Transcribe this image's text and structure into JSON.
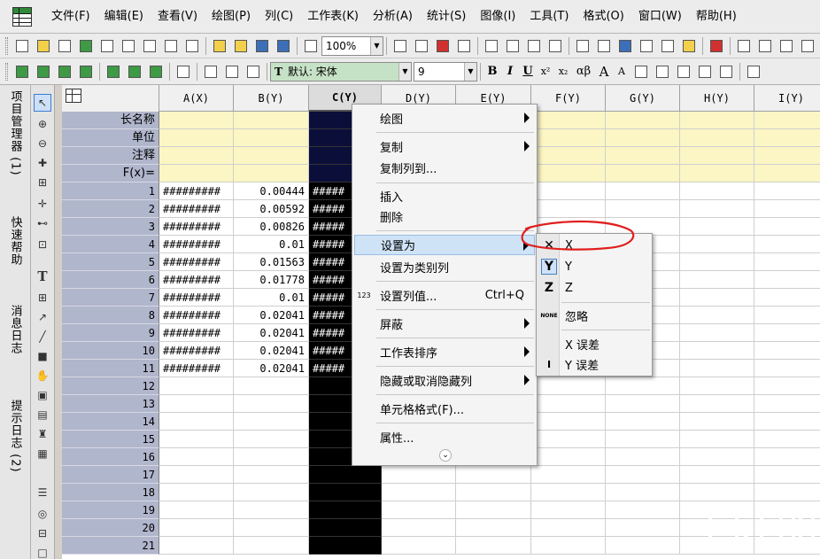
{
  "menubar": {
    "items": [
      "文件(F)",
      "编辑(E)",
      "查看(V)",
      "绘图(P)",
      "列(C)",
      "工作表(K)",
      "分析(A)",
      "统计(S)",
      "图像(I)",
      "工具(T)",
      "格式(O)",
      "窗口(W)",
      "帮助(H)"
    ]
  },
  "toolbar": {
    "zoom": "100%",
    "font": "默认: 宋体",
    "font_size": "9",
    "bold": "B",
    "italic": "I",
    "underline": "U",
    "superscript": "x²",
    "subscript": "x₂",
    "greek": "αβ",
    "grow_font": "A",
    "shrink_font": "A"
  },
  "side_tabs": [
    "项目管理器 (1)",
    "快速帮助",
    "消息日志",
    "提示日志 (2)"
  ],
  "sheet": {
    "columns": [
      "A(X)",
      "B(Y)",
      "C(Y)",
      "D(Y)",
      "E(Y)",
      "F(Y)",
      "G(Y)",
      "H(Y)",
      "I(Y)"
    ],
    "meta_rows": [
      "长名称",
      "单位",
      "注释",
      "F(x)="
    ],
    "rows": [
      {
        "n": "1",
        "a": "#########",
        "b": "0.00444",
        "c": "#####"
      },
      {
        "n": "2",
        "a": "#########",
        "b": "0.00592",
        "c": "#####"
      },
      {
        "n": "3",
        "a": "#########",
        "b": "0.00826",
        "c": "#####"
      },
      {
        "n": "4",
        "a": "#########",
        "b": "0.01",
        "c": "#####"
      },
      {
        "n": "5",
        "a": "#########",
        "b": "0.01563",
        "c": "#####"
      },
      {
        "n": "6",
        "a": "#########",
        "b": "0.01778",
        "c": "#####"
      },
      {
        "n": "7",
        "a": "#########",
        "b": "0.01",
        "c": "#####"
      },
      {
        "n": "8",
        "a": "#########",
        "b": "0.02041",
        "c": "#####"
      },
      {
        "n": "9",
        "a": "#########",
        "b": "0.02041",
        "c": "#####"
      },
      {
        "n": "10",
        "a": "#########",
        "b": "0.02041",
        "c": "#####"
      },
      {
        "n": "11",
        "a": "#########",
        "b": "0.02041",
        "c": "#####"
      },
      {
        "n": "12",
        "a": "",
        "b": "",
        "c": ""
      },
      {
        "n": "13",
        "a": "",
        "b": "",
        "c": ""
      },
      {
        "n": "14",
        "a": "",
        "b": "",
        "c": ""
      },
      {
        "n": "15",
        "a": "",
        "b": "",
        "c": ""
      },
      {
        "n": "16",
        "a": "",
        "b": "",
        "c": ""
      },
      {
        "n": "17",
        "a": "",
        "b": "",
        "c": ""
      },
      {
        "n": "18",
        "a": "",
        "b": "",
        "c": ""
      },
      {
        "n": "19",
        "a": "",
        "b": "",
        "c": ""
      },
      {
        "n": "20",
        "a": "",
        "b": "",
        "c": ""
      },
      {
        "n": "21",
        "a": "",
        "b": "",
        "c": ""
      }
    ]
  },
  "context_menu": {
    "items": [
      {
        "label": "绘图",
        "submenu": true
      },
      {
        "label": "复制",
        "submenu": true
      },
      {
        "label": "复制列到...",
        "submenu": false
      },
      {
        "label": "插入",
        "submenu": false
      },
      {
        "label": "删除",
        "submenu": false
      },
      {
        "label": "设置为",
        "submenu": true
      },
      {
        "label": "设置为类别列",
        "submenu": false
      },
      {
        "label": "设置列值...",
        "submenu": false,
        "shortcut": "Ctrl+Q"
      },
      {
        "label": "屏蔽",
        "submenu": true
      },
      {
        "label": "工作表排序",
        "submenu": true
      },
      {
        "label": "隐藏或取消隐藏列",
        "submenu": true
      },
      {
        "label": "单元格格式(F)...",
        "submenu": false
      },
      {
        "label": "属性...",
        "submenu": false
      }
    ],
    "set_col_icon": "123"
  },
  "submenu": {
    "items": [
      {
        "label": "X",
        "icon": "✕"
      },
      {
        "label": "Y",
        "icon": "Y"
      },
      {
        "label": "Z",
        "icon": "Z"
      },
      {
        "label": "忽略",
        "icon": "NONE"
      },
      {
        "label": "X 误差",
        "icon": ""
      },
      {
        "label": "Y 误差",
        "icon": "I"
      }
    ]
  },
  "colors": {
    "selected_column": "#000000",
    "annotation": "#e0201f",
    "meta_row_bg": "#fbf6c4",
    "row_header_bg": "#b0b6cc"
  }
}
